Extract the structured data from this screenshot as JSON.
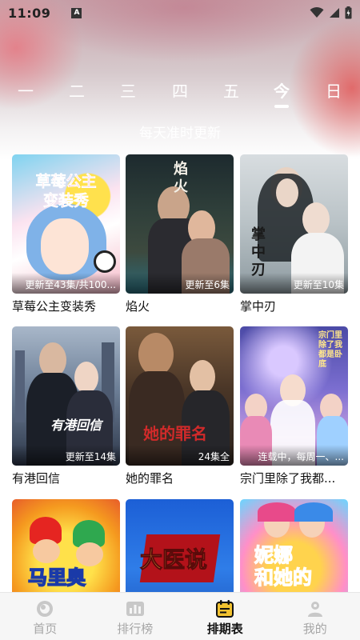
{
  "status_bar": {
    "time": "11:09",
    "notification_glyph": "A"
  },
  "days": [
    {
      "label": "一",
      "active": false
    },
    {
      "label": "二",
      "active": false
    },
    {
      "label": "三",
      "active": false
    },
    {
      "label": "四",
      "active": false
    },
    {
      "label": "五",
      "active": false
    },
    {
      "label": "今",
      "active": true
    },
    {
      "label": "日",
      "active": false
    }
  ],
  "subtitle": "每天准时更新",
  "shows": [
    {
      "title": "草莓公主变装秀",
      "badge": "更新至43集/共100...",
      "poster_text": "草莓公主变装秀"
    },
    {
      "title": "焰火",
      "badge": "更新至6集",
      "poster_text": "焰火"
    },
    {
      "title": "掌中刃",
      "badge": "更新至10集",
      "poster_text": "掌中刃"
    },
    {
      "title": "有港回信",
      "badge": "更新至14集",
      "poster_text": "有港回信"
    },
    {
      "title": "她的罪名",
      "badge": "24集全",
      "poster_text": "她的罪名"
    },
    {
      "title": "宗门里除了我都...",
      "badge": "连载中，每周一、...",
      "poster_text": "宗门里除了我都是卧底"
    },
    {
      "title": "",
      "badge": "",
      "poster_text": "马里奥"
    },
    {
      "title": "",
      "badge": "",
      "poster_text": "大医说"
    },
    {
      "title": "",
      "badge": "",
      "poster_text": "妮娜和她的"
    }
  ],
  "nav": [
    {
      "label": "首页",
      "icon": "home-icon",
      "active": false
    },
    {
      "label": "排行榜",
      "icon": "ranking-icon",
      "active": false
    },
    {
      "label": "排期表",
      "icon": "schedule-icon",
      "active": true
    },
    {
      "label": "我的",
      "icon": "profile-icon",
      "active": false
    }
  ],
  "colors": {
    "accent": "#111111",
    "nav_inactive": "#a6a6a6",
    "hero_red": "#e15f5f"
  }
}
